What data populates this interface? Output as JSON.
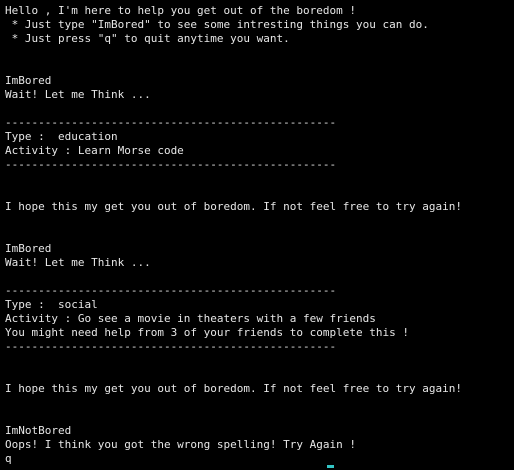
{
  "terminal": {
    "lines": [
      "Hello , I'm here to help you get out of the boredom !",
      " * Just type \"ImBored\" to see some intresting things you can do.",
      " * Just press \"q\" to quit anytime you want.",
      "",
      "",
      "ImBored",
      "Wait! Let me Think ...",
      "",
      "--------------------------------------------------",
      "Type :  education",
      "Activity : Learn Morse code",
      "--------------------------------------------------",
      "",
      "",
      "I hope this my get you out of boredom. If not feel free to try again!",
      "",
      "",
      "ImBored",
      "Wait! Let me Think ...",
      "",
      "--------------------------------------------------",
      "Type :  social",
      "Activity : Go see a movie in theaters with a few friends",
      "You might need help from 3 of your friends to complete this !",
      "--------------------------------------------------",
      "",
      "",
      "I hope this my get you out of boredom. If not feel free to try again!",
      "",
      "",
      "ImNotBored",
      "Oops! I think you got the wrong spelling! Try Again !",
      "q"
    ],
    "cursor_color": "#33c5c5",
    "background": "#000000",
    "text_color": "#e6e6e6"
  }
}
